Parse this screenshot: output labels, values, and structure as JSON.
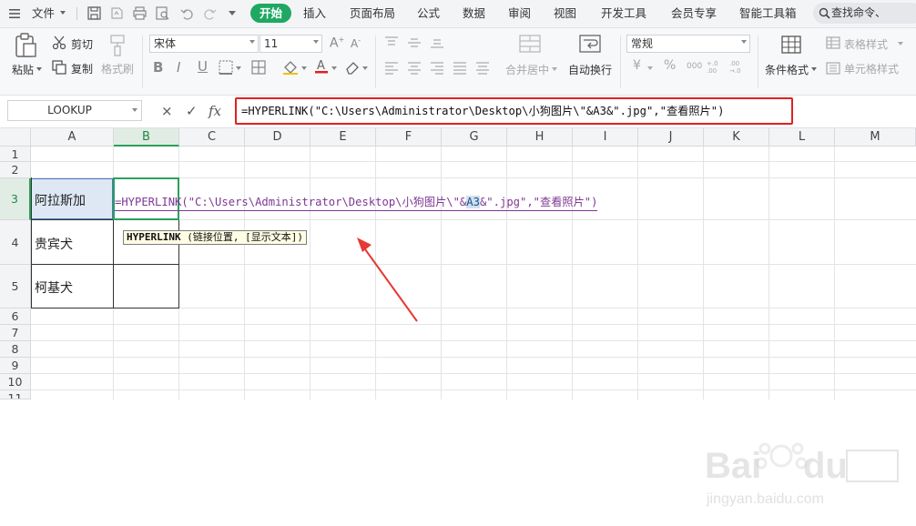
{
  "menubar": {
    "file_menu": "文件",
    "tabs": [
      "开始",
      "插入",
      "页面布局",
      "公式",
      "数据",
      "审阅",
      "视图",
      "开发工具",
      "会员专享",
      "智能工具箱"
    ],
    "active_tab": "开始",
    "search_placeholder": "查找命令、"
  },
  "ribbon": {
    "paste": "粘贴",
    "cut": "剪切",
    "copy": "复制",
    "format_painter": "格式刷",
    "font_name": "宋体",
    "font_size": "11",
    "merge_center": "合并居中",
    "wrap_text": "自动换行",
    "number_format": "常规",
    "conditional_format": "条件格式",
    "table_style": "表格样式",
    "cell_style": "单元格样式",
    "currency_symbol": "¥",
    "percent_symbol": "%",
    "thousands_symbol": "000"
  },
  "formula_bar": {
    "name_box": "LOOKUP",
    "cancel": "×",
    "confirm": "✓",
    "fx": "fx",
    "formula": "=HYPERLINK(\"C:\\Users\\Administrator\\Desktop\\小狗图片\\\"&A3&\".jpg\",\"查看照片\")"
  },
  "grid": {
    "columns": [
      "A",
      "B",
      "C",
      "D",
      "E",
      "F",
      "G",
      "H",
      "I",
      "J",
      "K",
      "L",
      "M"
    ],
    "rows": [
      "1",
      "2",
      "3",
      "4",
      "5",
      "6",
      "7",
      "8",
      "9",
      "10",
      "11"
    ],
    "active_column": "B",
    "active_row": "3",
    "cells": {
      "A3": "阿拉斯加",
      "A4": "贵宾犬",
      "A5": "柯基犬"
    },
    "editing": {
      "before_ref": "=HYPERLINK(\"C:\\Users\\Administrator\\Desktop\\小狗图片\\\"&",
      "ref": "A3",
      "after_ref": "&\".jpg\",\"查看照片\")"
    },
    "tooltip_func": "HYPERLINK",
    "tooltip_args": "(链接位置, [显示文本])"
  },
  "colors": {
    "accent_green": "#1fa862",
    "highlight_red": "#e02020",
    "arrow_red": "#e53935",
    "edit_purple": "#7e3794"
  }
}
